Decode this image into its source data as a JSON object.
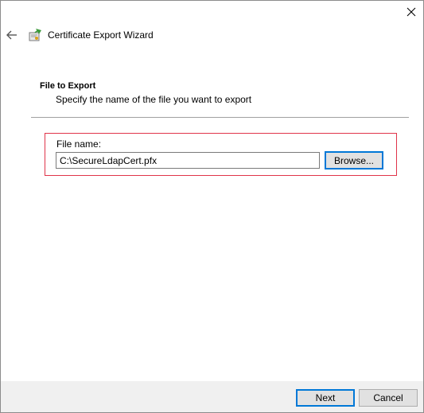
{
  "window": {
    "title": "Certificate Export Wizard",
    "close_icon": "close-icon",
    "back_icon": "back-arrow-icon",
    "app_icon": "certificate-wizard-icon"
  },
  "page": {
    "heading": "File to Export",
    "subheading": "Specify the name of the file you want to export"
  },
  "file": {
    "label": "File name:",
    "value": "C:\\SecureLdapCert.pfx",
    "browse_label": "Browse..."
  },
  "footer": {
    "next_label": "Next",
    "cancel_label": "Cancel"
  },
  "colors": {
    "accent": "#0078d7",
    "highlight": "#e0344a",
    "footer_bg": "#f0f0f0"
  }
}
